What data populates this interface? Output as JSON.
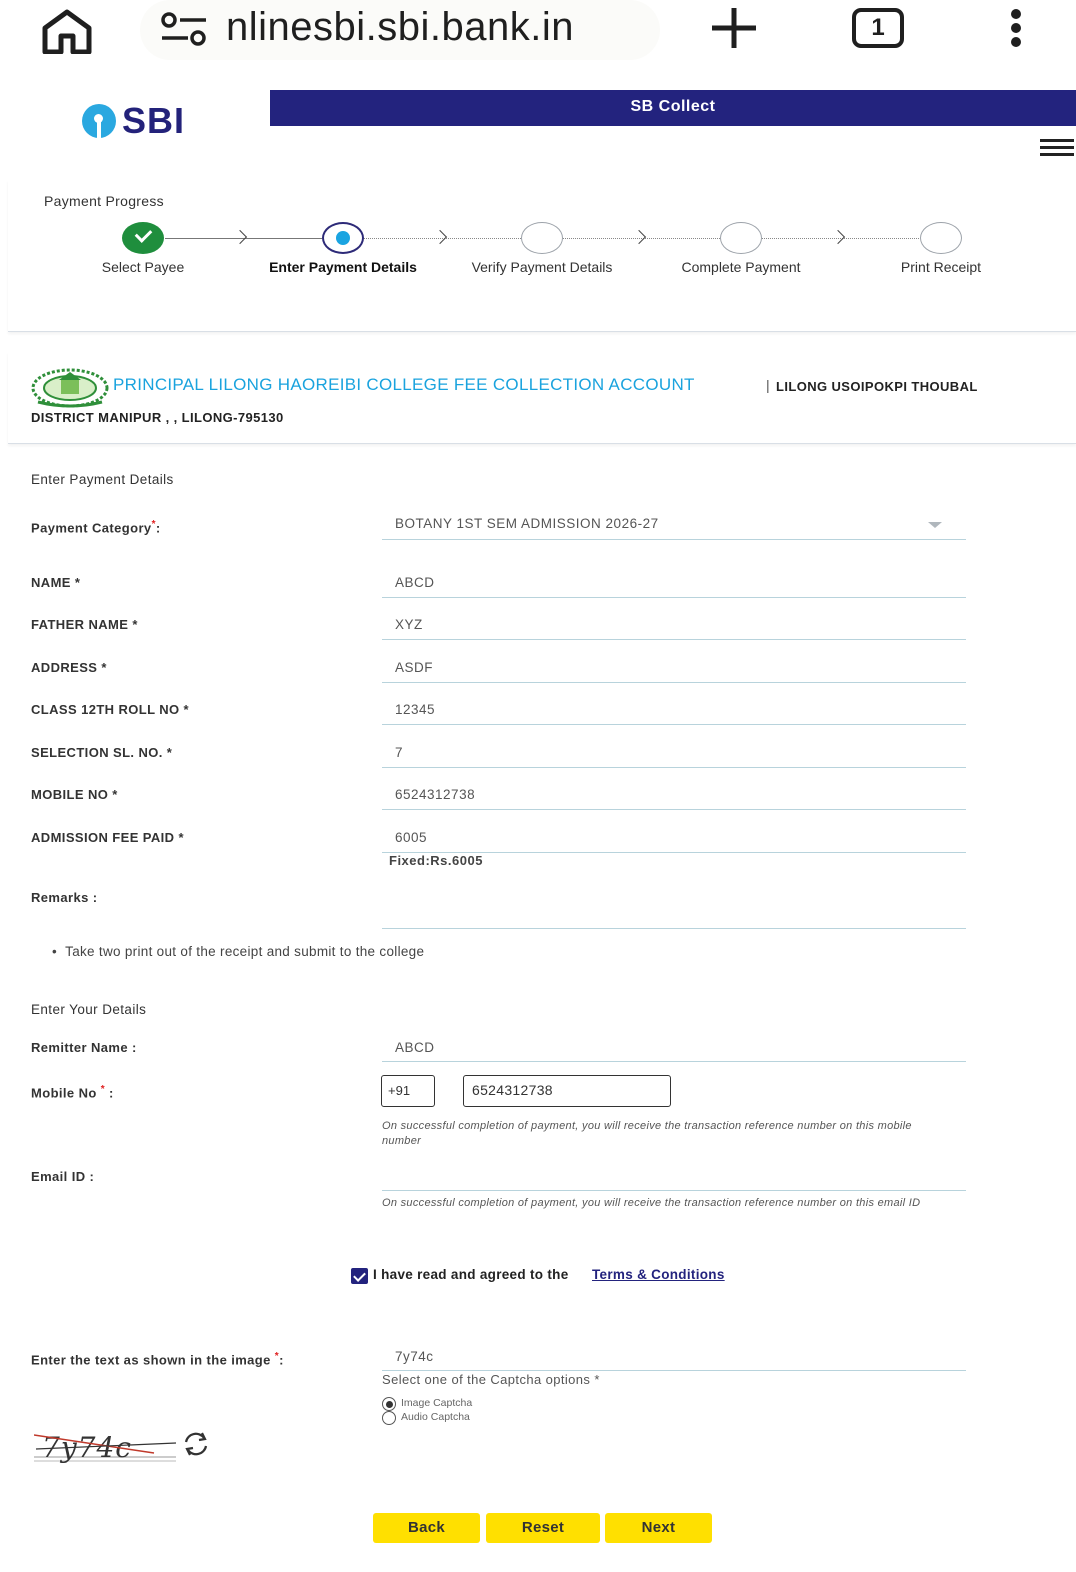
{
  "browser": {
    "url": "onlinesbi.sbi.bank.in",
    "url_display": "nlinesbi.sbi.bank.in",
    "tab_count": "1"
  },
  "header": {
    "logo_text": "SBI",
    "banner_title": "SB Collect"
  },
  "progress": {
    "title": "Payment Progress",
    "steps": [
      {
        "label": "Select Payee",
        "state": "done"
      },
      {
        "label": "Enter Payment Details",
        "state": "current"
      },
      {
        "label": "Verify Payment Details",
        "state": "todo"
      },
      {
        "label": "Complete Payment",
        "state": "todo"
      },
      {
        "label": "Print Receipt",
        "state": "todo"
      }
    ]
  },
  "payee": {
    "name": "PRINCIPAL LILONG HAOREIBI COLLEGE FEE COLLECTION ACCOUNT",
    "separator": "|",
    "address_line1": "LILONG USOIPOKPI THOUBAL",
    "address_line2": "DISTRICT MANIPUR , , LILONG-795130"
  },
  "payment_details": {
    "section_title": "Enter Payment Details",
    "category_label": "Payment Category",
    "category_value": "BOTANY 1ST SEM ADMISSION 2026-27",
    "fields": [
      {
        "label": "NAME",
        "value": "ABCD"
      },
      {
        "label": "FATHER NAME",
        "value": "XYZ"
      },
      {
        "label": "ADDRESS",
        "value": "ASDF"
      },
      {
        "label": "CLASS 12TH ROLL NO",
        "value": "12345"
      },
      {
        "label": "SELECTION SL. NO.",
        "value": "7"
      },
      {
        "label": "MOBILE NO",
        "value": "6524312738"
      },
      {
        "label": "ADMISSION FEE PAID",
        "value": "6005"
      }
    ],
    "fee_hint": "Fixed:Rs.6005",
    "remarks_label": "Remarks :",
    "remarks_value": "",
    "note": "Take two print out of the receipt and submit to the college"
  },
  "your_details": {
    "section_title": "Enter Your Details",
    "remitter_label": "Remitter Name :",
    "remitter_value": "ABCD",
    "mobile_label": "Mobile No",
    "country_code": "+91",
    "mobile_value": "6524312738",
    "mobile_note": "On successful completion of payment, you will receive the transaction reference number on this mobile number",
    "email_label": "Email ID :",
    "email_value": "",
    "email_note": "On successful completion of payment, you will receive the transaction reference number on this email ID"
  },
  "agreement": {
    "checked": true,
    "text": "I have read and agreed to the",
    "link": "Terms & Conditions"
  },
  "captcha": {
    "label": "Enter the text as shown in the image",
    "value": "7y74c",
    "options_title": "Select one of the Captcha options",
    "options": [
      {
        "label": "Image Captcha",
        "selected": true
      },
      {
        "label": "Audio Captcha",
        "selected": false
      }
    ],
    "image_text": "7y74c"
  },
  "buttons": {
    "back": "Back",
    "reset": "Reset",
    "next": "Next"
  },
  "colors": {
    "brand_navy": "#23237e",
    "accent_blue": "#1aa3de",
    "success_green": "#1f8e3d",
    "button_yellow": "#ffe000",
    "required_red": "#e02020"
  }
}
